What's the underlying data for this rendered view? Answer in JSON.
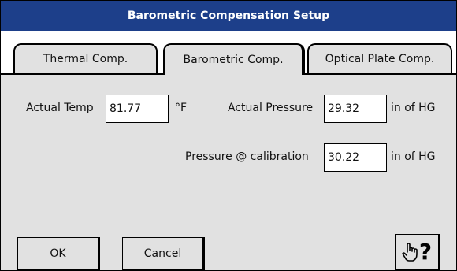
{
  "window": {
    "title": "Barometric Compensation Setup"
  },
  "tabs": [
    {
      "label": "Thermal Comp."
    },
    {
      "label": "Barometric Comp."
    },
    {
      "label": "Optical Plate Comp."
    }
  ],
  "fields": {
    "actual_temp": {
      "label": "Actual Temp",
      "value": "81.77",
      "unit": "°F"
    },
    "actual_pressure": {
      "label": "Actual Pressure",
      "value": "29.32",
      "unit": "in of HG"
    },
    "pressure_calibration": {
      "label": "Pressure @ calibration",
      "value": "30.22",
      "unit": "in of HG"
    }
  },
  "buttons": {
    "ok": "OK",
    "cancel": "Cancel",
    "help_icon": "pointing-hand-help-icon"
  }
}
